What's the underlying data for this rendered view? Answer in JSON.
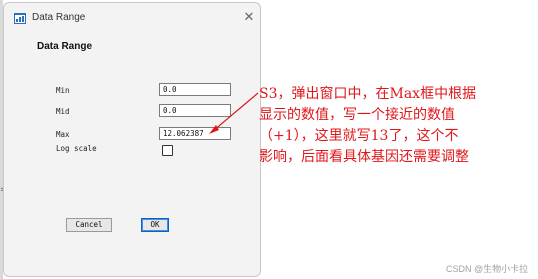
{
  "window": {
    "title": "Data Range",
    "close_glyph": "✕"
  },
  "dialog": {
    "heading": "Data Range",
    "fields": {
      "min": {
        "label": "Min",
        "value": "0.0"
      },
      "mid": {
        "label": "Mid",
        "value": "0.0"
      },
      "max": {
        "label": "Max",
        "value": "12.062387"
      }
    },
    "log_scale": {
      "label": "Log scale",
      "checked": false
    },
    "buttons": {
      "cancel": "Cancel",
      "ok": "OK"
    }
  },
  "annotation": {
    "lines": [
      "S3，弹出窗口中，在Max框中根据",
      "显示的数值，写一个接近的数值",
      "（+1），这里就写13了，这个不",
      "影响，后面看具体基因还需要调整"
    ],
    "color": "#e0161a"
  },
  "watermark": "CSDN @生物小卡拉",
  "icons": {
    "app": "chart-app-icon",
    "close": "close-icon",
    "arrow": "annotation-arrow"
  }
}
